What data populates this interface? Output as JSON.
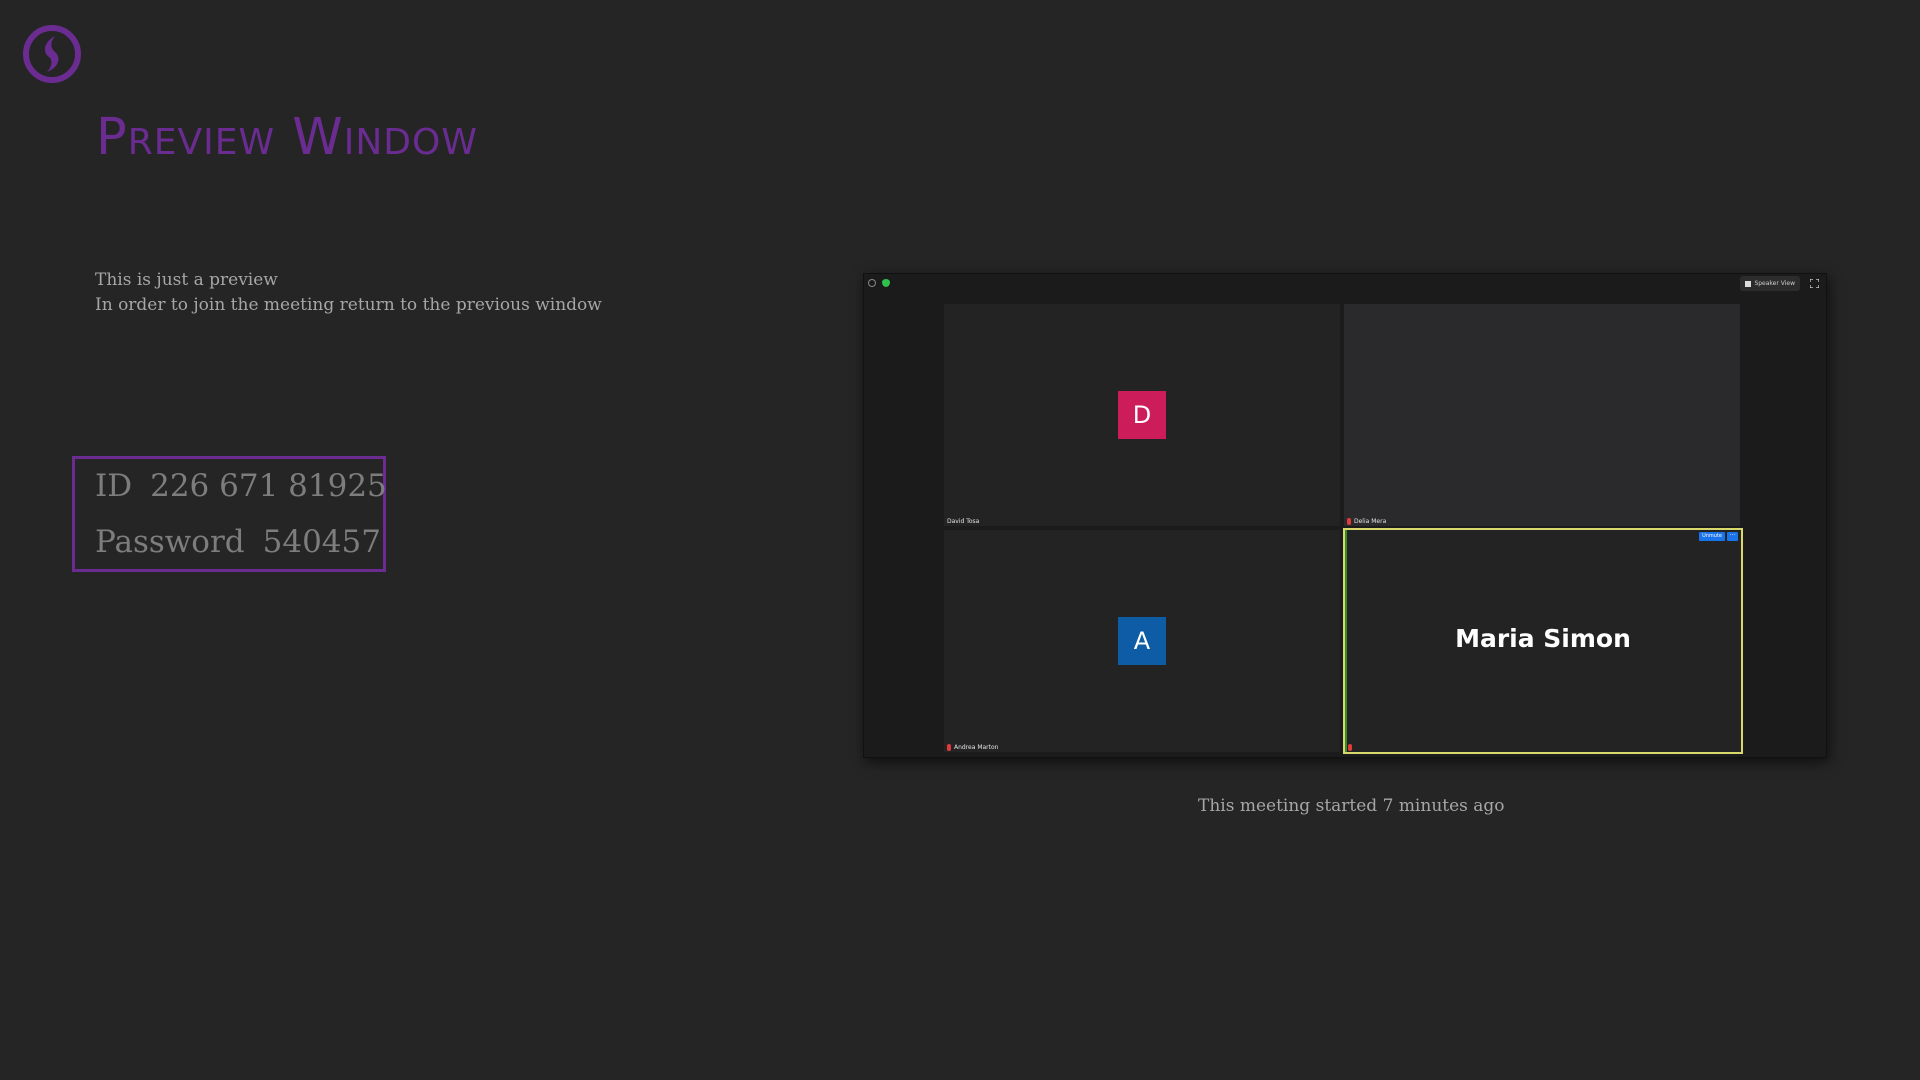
{
  "header": {
    "title": "Preview Window",
    "logo_icon": "app-logo-icon",
    "accent_color": "#6a2c91"
  },
  "info": {
    "line1": "This is just a preview",
    "line2": "In order to join the meeting return to the previous window"
  },
  "credentials": {
    "id_label": "ID",
    "id_value": "226 671 81925",
    "password_label": "Password",
    "password_value": "540457"
  },
  "preview": {
    "speaker_view_label": "Speaker View",
    "participants": [
      {
        "name": "David Tosa",
        "initial": "D",
        "color": "#cc1d5a",
        "muted": false
      },
      {
        "name": "Delia Mera",
        "initial": "",
        "color": "",
        "muted": true
      },
      {
        "name": "Andrea Marton",
        "initial": "A",
        "color": "#0e5ca6",
        "muted": true
      },
      {
        "name": "Maria Simon",
        "display_name": "Maria Simon",
        "muted": true,
        "active": true
      }
    ],
    "unmute_label": "Unmute",
    "more_label": "···"
  },
  "status": {
    "text": "This meeting started 7 minutes ago"
  }
}
